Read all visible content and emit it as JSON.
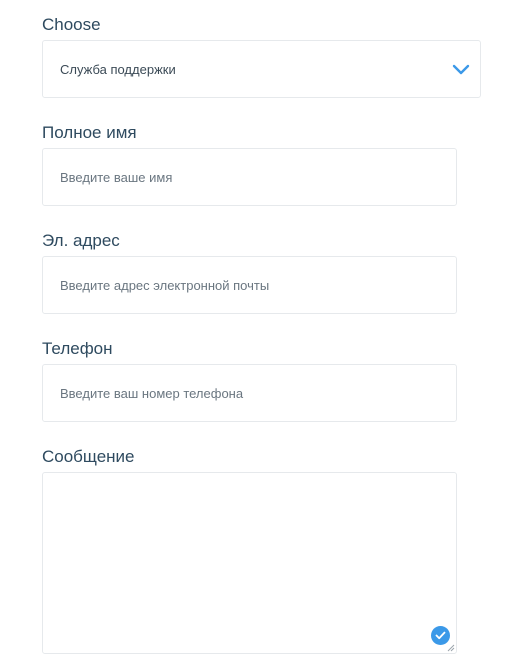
{
  "form": {
    "department": {
      "label": "Choose",
      "selected": "Служба поддержки",
      "icon": "chevron-down-icon"
    },
    "full_name": {
      "label": "Полное имя",
      "placeholder": "Введите ваше имя",
      "value": ""
    },
    "email": {
      "label": "Эл. адрес",
      "placeholder": "Введите адрес электронной почты",
      "value": ""
    },
    "phone": {
      "label": "Телефон",
      "placeholder": "Введите ваш номер телефона",
      "value": ""
    },
    "message": {
      "label": "Сообщение",
      "value": "",
      "badge_icon": "checkmark-icon"
    }
  },
  "colors": {
    "label_text": "#2e4a5f",
    "accent": "#3b99e8",
    "border": "#e6e9ec",
    "placeholder": "#6a7680"
  }
}
